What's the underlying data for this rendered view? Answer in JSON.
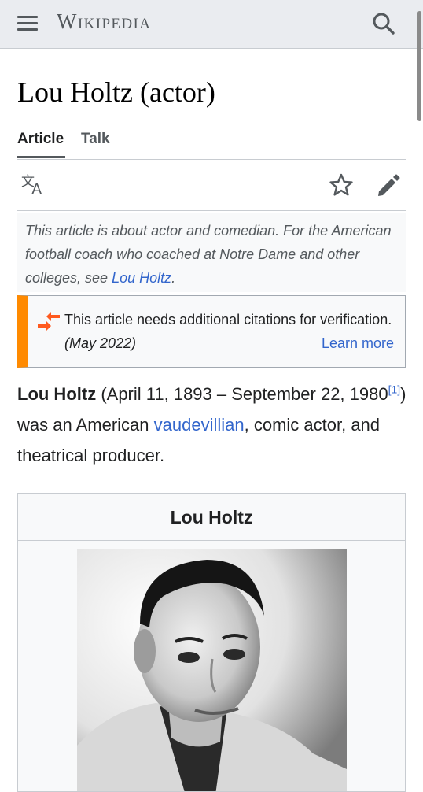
{
  "header": {
    "menu_icon": "hamburger-menu-icon",
    "wordmark": "Wikipedia",
    "search_icon": "search-icon"
  },
  "page": {
    "title": "Lou Holtz (actor)"
  },
  "tabs": [
    {
      "label": "Article",
      "active": true
    },
    {
      "label": "Talk",
      "active": false
    }
  ],
  "actions": {
    "language_icon": "translate-icon",
    "watch_icon": "star-icon",
    "edit_icon": "pencil-icon"
  },
  "hatnote": {
    "text": "This article is about actor and comedian. For the American football coach who coached at Notre Dame and other colleges, see ",
    "link": "Lou Holtz",
    "end": "."
  },
  "notice": {
    "icon": "citation-needed-icon",
    "text": "This article needs additional citations for verification.",
    "date": "(May 2022)",
    "learn_more": "Learn more"
  },
  "lead": {
    "subject": "Lou Holtz",
    "dates": " (April 11, 1893 – September 22, 1980",
    "ref": "[1]",
    "mid": ") was an American ",
    "link": "vaudevillian",
    "end": ", comic actor, and theatrical producer."
  },
  "infobox": {
    "title": "Lou Holtz",
    "image": "portrait-photo"
  },
  "colors": {
    "header_bg": "#eaecf0",
    "link": "#3366cc",
    "notice_accent": "#ff8a00"
  }
}
